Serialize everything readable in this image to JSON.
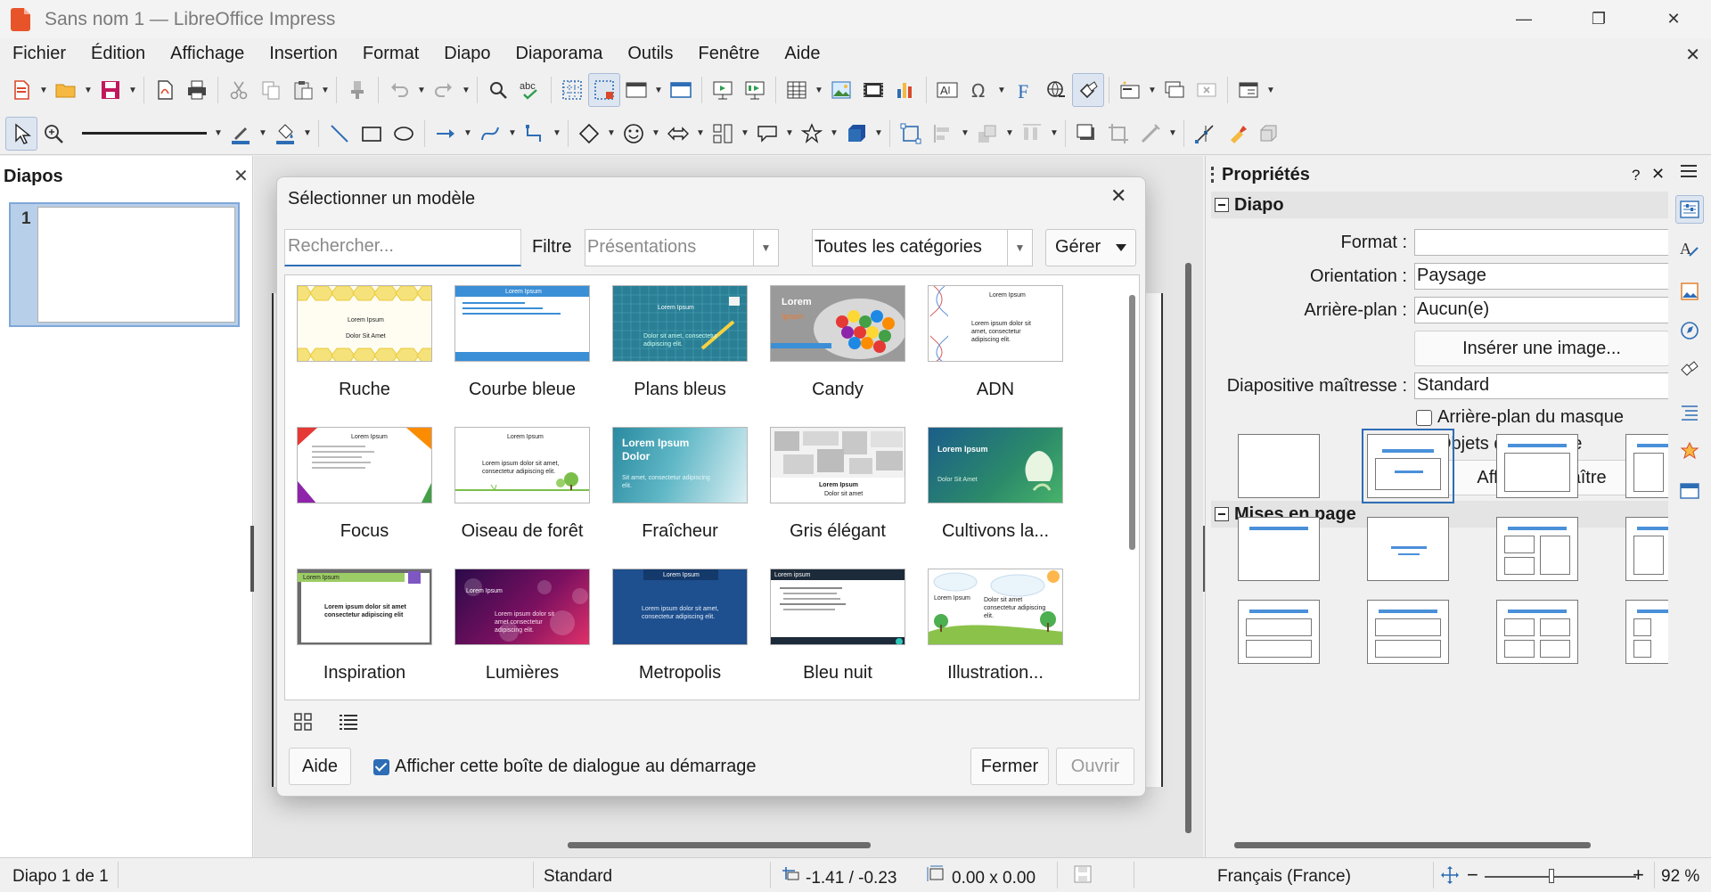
{
  "window": {
    "title": "Sans nom 1 — LibreOffice Impress",
    "controls": [
      "—",
      "❐",
      "✕"
    ]
  },
  "menu": [
    "Fichier",
    "Édition",
    "Affichage",
    "Insertion",
    "Format",
    "Diapo",
    "Diaporama",
    "Outils",
    "Fenêtre",
    "Aide"
  ],
  "menu_close": "✕",
  "slides_pane": {
    "title": "Diapos",
    "close": "✕",
    "slide_number": "1"
  },
  "properties": {
    "title": "Propriétés",
    "help": "?",
    "close": "✕",
    "section_slide": "Diapo",
    "format_label": "Format :",
    "format_value": "",
    "orientation_label": "Orientation :",
    "orientation_value": "Paysage",
    "background_label": "Arrière-plan :",
    "background_value": "Aucun(e)",
    "insert_image": "Insérer une image...",
    "master_label": "Diapositive maîtresse :",
    "master_value": "Standard",
    "master_background": "Arrière-plan du masque",
    "master_objects": "Objets du masque",
    "master_view": "Affichage maître",
    "section_layouts": "Mises en page"
  },
  "dialog": {
    "title": "Sélectionner un modèle",
    "close": "✕",
    "search_placeholder": "Rechercher...",
    "filter_label": "Filtre",
    "filter_value": "Présentations",
    "category_value": "Toutes les catégories",
    "manage": "Gérer",
    "templates": [
      {
        "name": "Ruche",
        "thumb_title": "Lorem Ipsum",
        "thumb_sub": "Dolor Sit Amet"
      },
      {
        "name": "Courbe bleue",
        "thumb_title": "Lorem Ipsum",
        "thumb_sub": ""
      },
      {
        "name": "Plans bleus",
        "thumb_title": "Lorem Ipsum",
        "thumb_sub": "Dolor sit amet, consectetur adipiscing elit."
      },
      {
        "name": "Candy",
        "thumb_title": "Lorem",
        "thumb_sub": "Ipsum"
      },
      {
        "name": "ADN",
        "thumb_title": "Lorem Ipsum",
        "thumb_sub": "Lorem ipsum dolor sit amet, consectetur adipiscing elit."
      },
      {
        "name": "Focus",
        "thumb_title": "Lorem Ipsum",
        "thumb_sub": ""
      },
      {
        "name": "Oiseau de forêt",
        "thumb_title": "Lorem Ipsum",
        "thumb_sub": "Lorem ipsum dolor sit amet, consectetur adipiscing elit."
      },
      {
        "name": "Fraîcheur",
        "thumb_title": "Lorem Ipsum Dolor",
        "thumb_sub": "Sit amet, consectetur adipiscing elit."
      },
      {
        "name": "Gris élégant",
        "thumb_title": "Lorem Ipsum",
        "thumb_sub": "Dolor sit amet"
      },
      {
        "name": "Cultivons la...",
        "thumb_title": "Lorem Ipsum",
        "thumb_sub": "Dolor Sit Amet"
      },
      {
        "name": "Inspiration",
        "thumb_title": "Lorem Ipsum",
        "thumb_sub": "Lorem ipsum dolor sit amet consectetur adipiscing elit"
      },
      {
        "name": "Lumières",
        "thumb_title": "Lorem Ipsum",
        "thumb_sub": "Lorem ipsum dolor sit amet consectetur adipiscing elit."
      },
      {
        "name": "Metropolis",
        "thumb_title": "Lorem Ipsum",
        "thumb_sub": "Lorem ipsum dolor sit amet, consectetur adipiscing elit."
      },
      {
        "name": "Bleu nuit",
        "thumb_title": "Lorem ipsum",
        "thumb_sub": ""
      },
      {
        "name": "Illustration...",
        "thumb_title": "Lorem Ipsum",
        "thumb_sub": "Dolor sit amet consectetur adipiscing elit."
      }
    ],
    "help_button": "Aide",
    "show_on_startup": "Afficher cette boîte de dialogue au démarrage",
    "close_button": "Fermer",
    "open_button": "Ouvrir"
  },
  "statusbar": {
    "slide_info": "Diapo 1 de 1",
    "master": "Standard",
    "position": "-1.41 / -0.23",
    "size": "0.00 x 0.00",
    "language": "Français (France)",
    "zoom": "92 %",
    "zoom_minus": "−",
    "zoom_plus": "+"
  },
  "colors": {
    "accent": "#2d6db5",
    "impress_orange": "#e8542a"
  }
}
